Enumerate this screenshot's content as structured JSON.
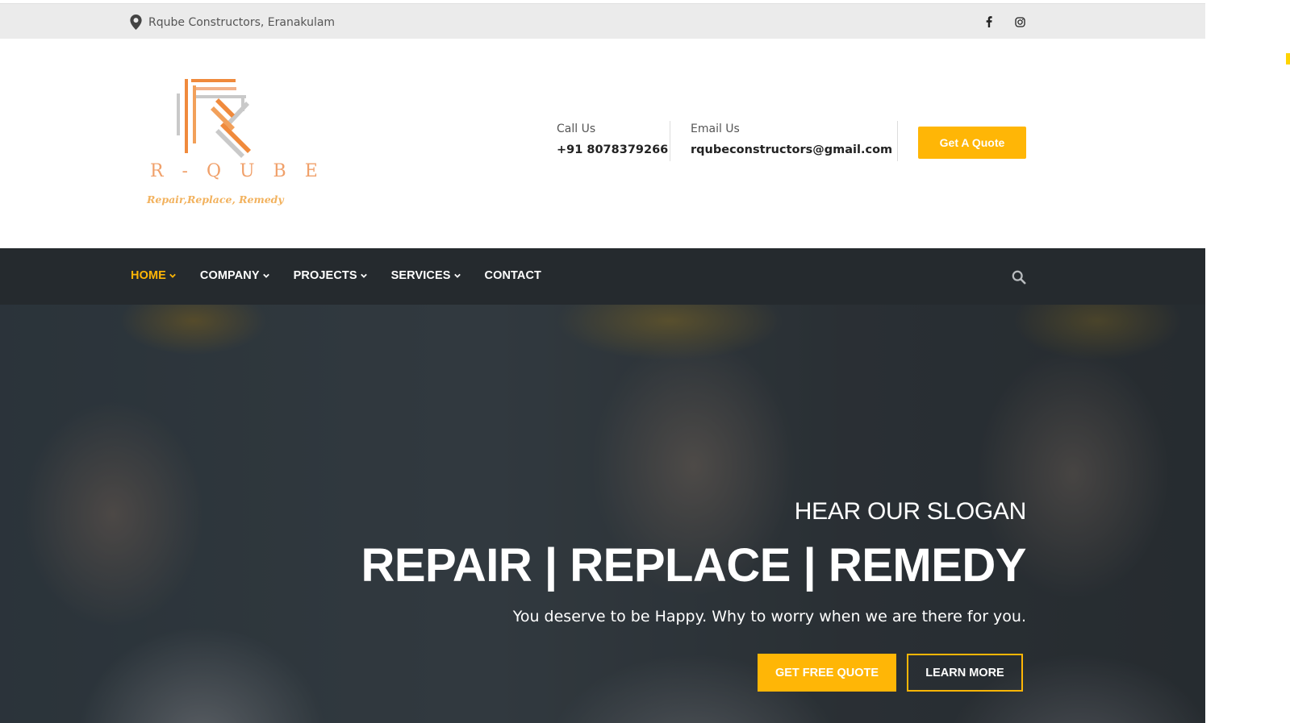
{
  "topbar": {
    "location": "Rqube Constructors, Eranakulam",
    "location_icon": "map-pin-icon",
    "social": [
      "facebook-icon",
      "instagram-icon"
    ]
  },
  "header": {
    "logo": {
      "wordmark": "R - Q U B E",
      "tagline": "Repair,Replace, Remedy"
    },
    "call": {
      "label": "Call Us",
      "value": "+91 8078379266"
    },
    "email": {
      "label": "Email Us",
      "value": "rqubeconstructors@gmail.com"
    },
    "quote_button": "Get A Quote"
  },
  "nav": {
    "items": [
      {
        "label": "HOME",
        "active": true,
        "dropdown": true
      },
      {
        "label": "COMPANY",
        "active": false,
        "dropdown": true
      },
      {
        "label": "PROJECTS",
        "active": false,
        "dropdown": true
      },
      {
        "label": "SERVICES",
        "active": false,
        "dropdown": true
      },
      {
        "label": "CONTACT",
        "active": false,
        "dropdown": false
      }
    ],
    "search_icon": "search-icon"
  },
  "hero": {
    "kicker": "HEAR OUR SLOGAN",
    "headline": "REPAIR | REPLACE | REMEDY",
    "subtext": "You deserve to be Happy. Why to worry when we are there for you.",
    "primary_button": "GET FREE QUOTE",
    "secondary_button": "LEARN MORE"
  },
  "colors": {
    "accent": "#ffb606",
    "nav_bg": "#252a2e",
    "topbar_bg": "#ebebeb"
  }
}
